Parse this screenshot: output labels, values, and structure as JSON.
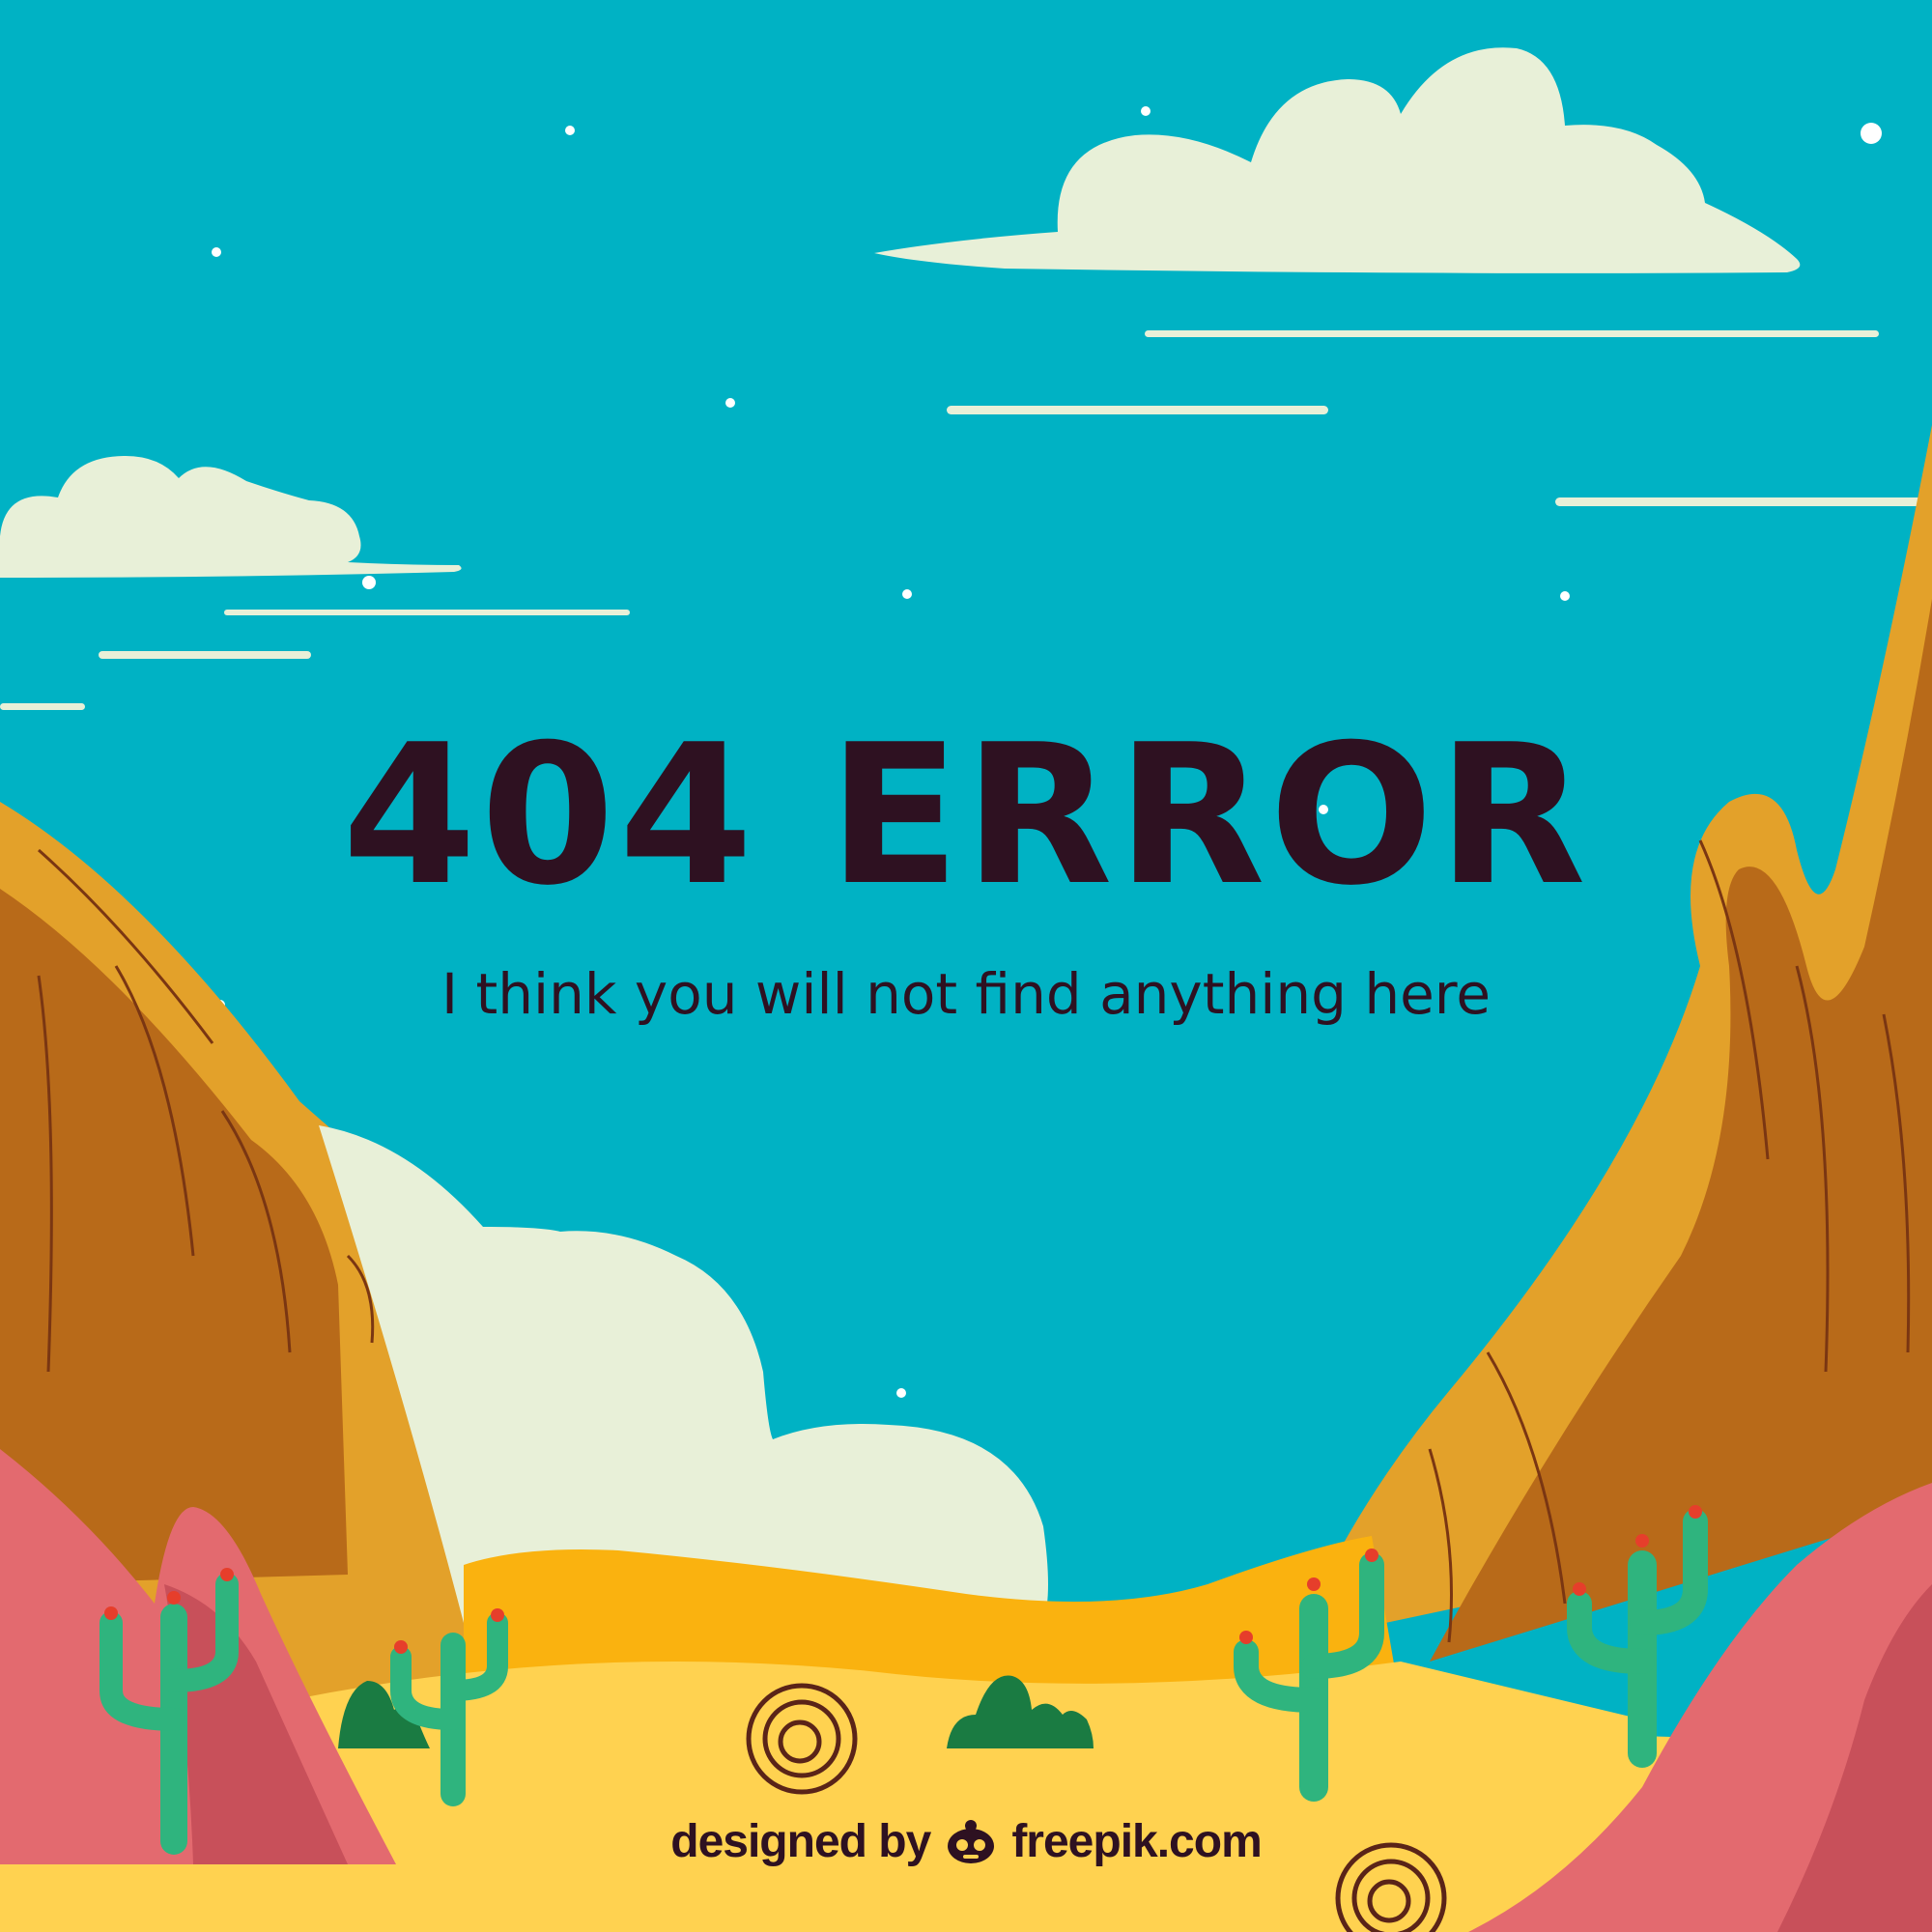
{
  "error": {
    "title": "404 ERROR",
    "message": "I think you will not find anything here"
  },
  "credit": {
    "prefix": "designed by",
    "brand": "freepik.com",
    "logo_icon": "freepik-logo-icon"
  },
  "colors": {
    "sky": "#00b2c4",
    "cloud": "#e8f0d8",
    "text": "#2e1121",
    "canyon_light": "#e3a12a",
    "canyon_dark": "#b86a19",
    "rock_pink": "#e36a6f",
    "sand": "#ffd250",
    "dune": "#fab20f",
    "cactus": "#2fb47e",
    "bush": "#1a7b42"
  }
}
